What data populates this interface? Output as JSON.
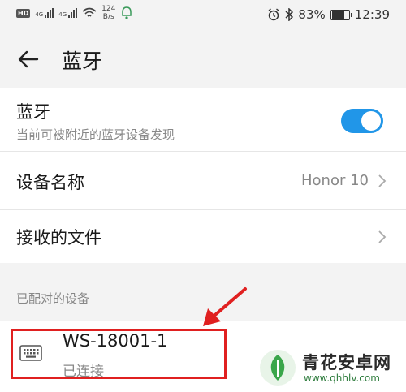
{
  "status_bar": {
    "hd": "HD",
    "network1": "4G",
    "network2": "4G",
    "speed_value": "124",
    "speed_unit": "B/s",
    "battery": "83%",
    "battery_level": 0.83,
    "time": "12:39"
  },
  "header": {
    "title": "蓝牙"
  },
  "bluetooth": {
    "title": "蓝牙",
    "subtitle": "当前可被附近的蓝牙设备发现",
    "enabled": true,
    "accent": "#2196e8"
  },
  "device_name": {
    "label": "设备名称",
    "value": "Honor 10"
  },
  "received_files": {
    "label": "接收的文件"
  },
  "paired_section": {
    "title": "已配对的设备"
  },
  "paired_devices": [
    {
      "name": "WS-18001-1",
      "status": "已连接"
    }
  ],
  "annotation_color": "#e02020",
  "watermark": {
    "name": "青花安卓网",
    "url": "www.qhhlv.com"
  }
}
